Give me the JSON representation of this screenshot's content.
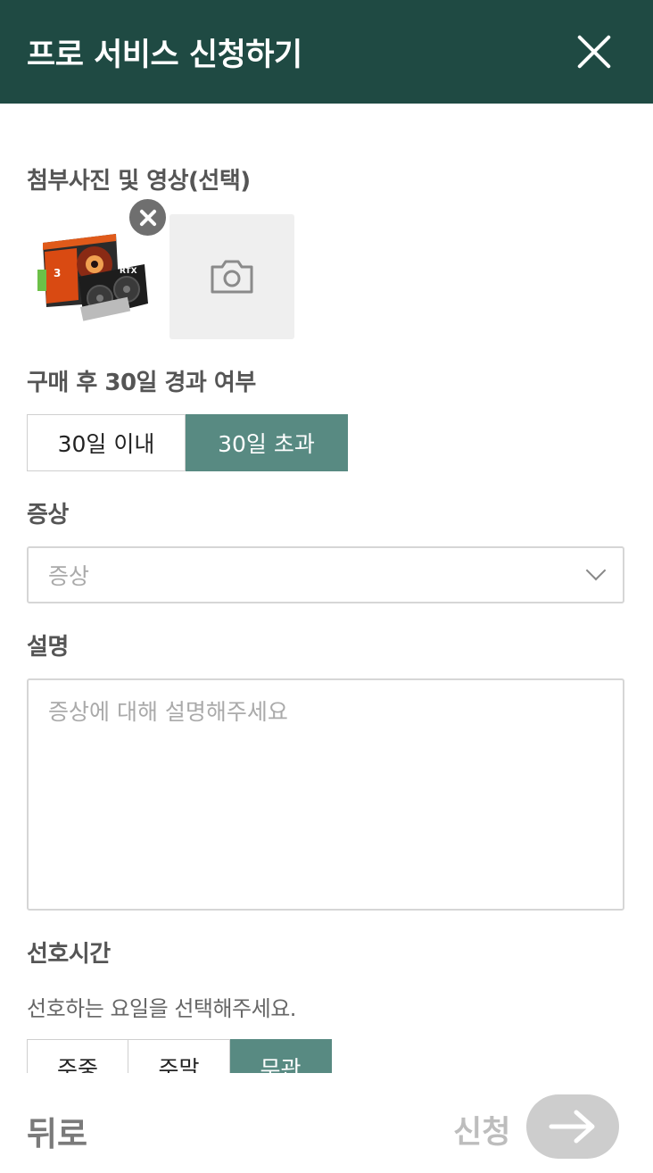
{
  "header": {
    "title": "프로 서비스 신청하기"
  },
  "attachments": {
    "label": "첨부사진 및 영상(선택)"
  },
  "purchase": {
    "label": "구매 후 30일 경과 여부",
    "options": [
      "30일 이내",
      "30일 초과"
    ],
    "selected": "30일 초과"
  },
  "symptom": {
    "label": "증상",
    "placeholder": "증상"
  },
  "description": {
    "label": "설명",
    "placeholder": "증상에 대해 설명해주세요"
  },
  "preferred_time": {
    "label": "선호시간",
    "hint": "선호하는 요일을 선택해주세요.",
    "days": [
      "주중",
      "주말",
      "무관"
    ],
    "selected": "무관"
  },
  "footer": {
    "back_label": "뒤로",
    "submit_label": "신청"
  },
  "colors": {
    "header_bg": "#1f4a43",
    "accent": "#588a82"
  }
}
